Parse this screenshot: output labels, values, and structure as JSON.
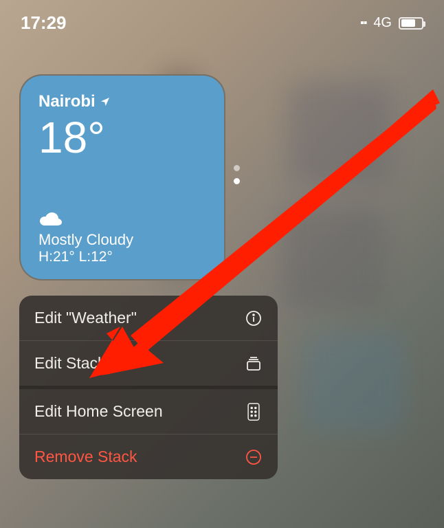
{
  "status": {
    "time": "17:29",
    "network": "4G"
  },
  "widget": {
    "location": "Nairobi",
    "temperature": "18°",
    "condition": "Mostly Cloudy",
    "high_low": "H:21° L:12°"
  },
  "menu": {
    "edit_widget": "Edit \"Weather\"",
    "edit_stack": "Edit Stack",
    "edit_home": "Edit Home Screen",
    "remove_stack": "Remove Stack"
  }
}
